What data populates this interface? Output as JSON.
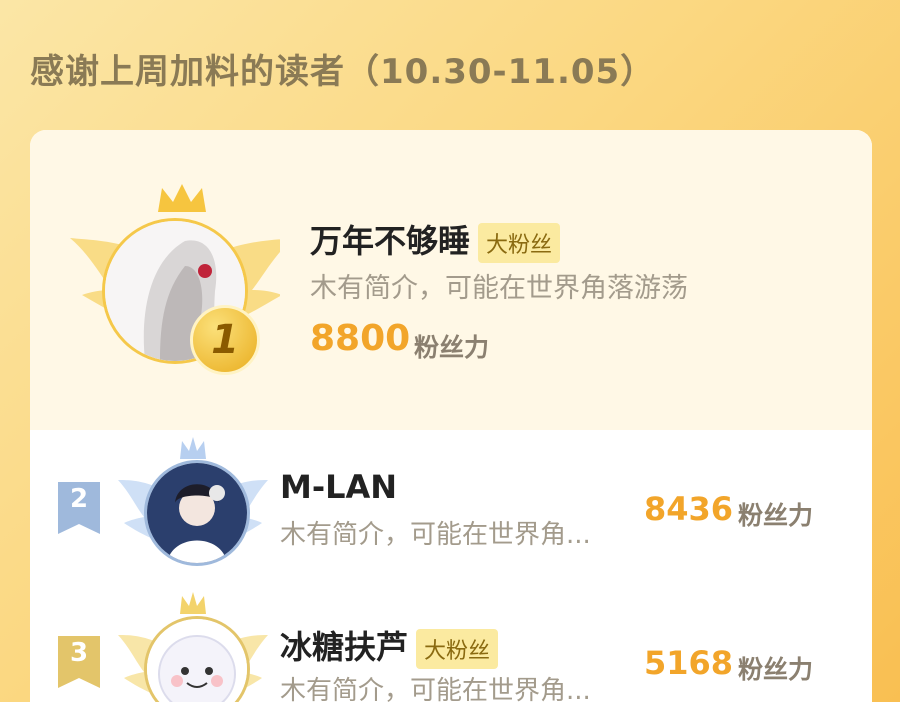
{
  "header": {
    "title": "感谢上周加料的读者（10.30-11.05）"
  },
  "ranking": [
    {
      "rank": "1",
      "name": "万年不够睡",
      "badge": "大粉丝",
      "intro": "木有简介，可能在世界角落游荡",
      "score": "8800",
      "unit": "粉丝力"
    },
    {
      "rank": "2",
      "name": "M-LAN",
      "badge": "",
      "intro": "木有简介，可能在世界角...",
      "score": "8436",
      "unit": "粉丝力"
    },
    {
      "rank": "3",
      "name": "冰糖扶芦",
      "badge": "大粉丝",
      "intro": "木有简介，可能在世界角...",
      "score": "5168",
      "unit": "粉丝力"
    }
  ],
  "colors": {
    "accent": "#f2a52a",
    "badge_bg": "#fbeaa0",
    "gold": "#f5c84a",
    "silver": "#a9c3e8",
    "bronze": "#e6c46a"
  }
}
